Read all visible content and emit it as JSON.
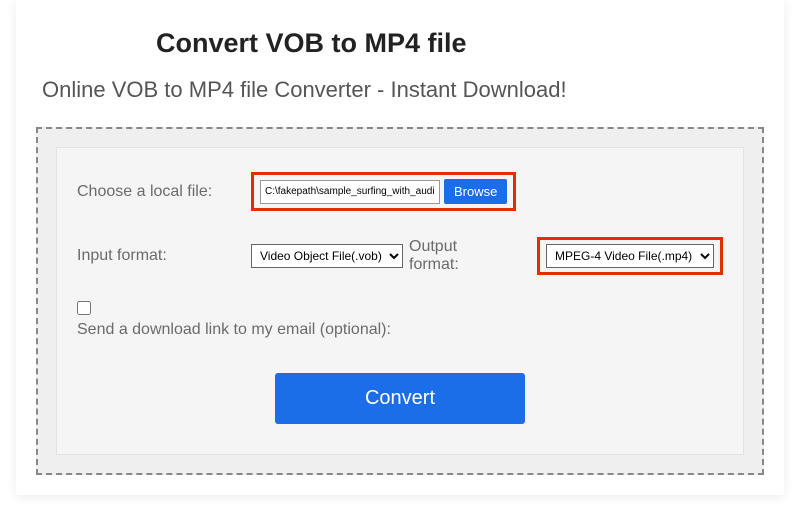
{
  "title": "Convert VOB to MP4 file",
  "subtitle": "Online VOB to MP4 file Converter - Instant Download!",
  "form": {
    "choose_file_label": "Choose a local file:",
    "file_value": "C:\\fakepath\\sample_surfing_with_audio.vob",
    "browse_label": "Browse",
    "input_format_label": "Input format:",
    "input_format_value": "Video Object File(.vob)",
    "output_format_label": "Output format:",
    "output_format_value": "MPEG-4 Video File(.mp4)",
    "email_label": "Send a download link to my email (optional):",
    "convert_label": "Convert"
  }
}
